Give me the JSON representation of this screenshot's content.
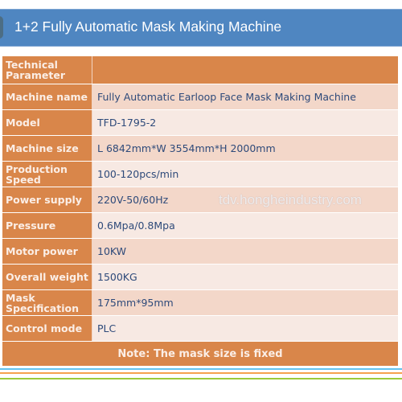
{
  "title": "1+2 Fully Automatic Mask Making Machine",
  "table": {
    "header_label": "Technical Parameter",
    "header_value": "",
    "rows": [
      {
        "label": "Machine name",
        "value": "Fully Automatic Earloop Face Mask Making Machine"
      },
      {
        "label": "Model",
        "value": "TFD-1795-2"
      },
      {
        "label": "Machine size",
        "value": "L 6842mm*W 3554mm*H 2000mm"
      },
      {
        "label": "Production Speed",
        "value": "100-120pcs/min"
      },
      {
        "label": "Power supply",
        "value": "220V-50/60Hz"
      },
      {
        "label": "Pressure",
        "value": "0.6Mpa/0.8Mpa"
      },
      {
        "label": "Motor power",
        "value": "10KW"
      },
      {
        "label": "Overall weight",
        "value": "1500KG"
      },
      {
        "label": "Mask Specification",
        "value": "175mm*95mm"
      },
      {
        "label": "Control mode",
        "value": "PLC"
      }
    ],
    "note": "Note: The mask size is fixed"
  },
  "watermark": "tdv.hongheindustry.com",
  "colors": {
    "title_bar": "#4f86c1",
    "label_cell": "#d9864a",
    "value_cell_dark": "#f3d7c9",
    "value_cell_light": "#f7e9e3",
    "value_text": "#2e4a7a",
    "line_blue": "#63c3ef",
    "line_orange": "#f5a24e",
    "line_green": "#9ccb3b"
  }
}
